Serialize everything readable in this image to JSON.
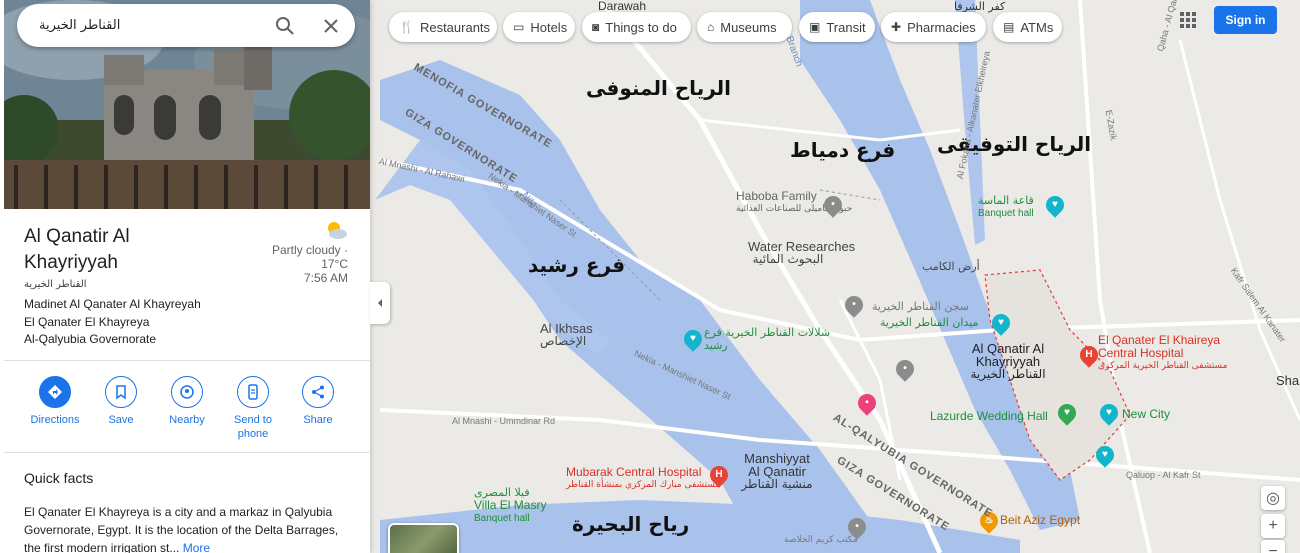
{
  "search": {
    "value": "القناطر الخيرية"
  },
  "place": {
    "name": "Al Qanatir Al Khayriyyah",
    "name_ar": "القناطر الخيرية",
    "address": [
      "Madinet Al Qanater Al Khayreyah",
      "El Qanater El Khayreya",
      "Al-Qalyubia Governorate"
    ]
  },
  "weather": {
    "condition": "Partly cloudy ·",
    "temp": "17°C",
    "time": "7:56 AM"
  },
  "actions": [
    {
      "label": "Directions",
      "icon": "directions-icon"
    },
    {
      "label": "Save",
      "icon": "bookmark-icon"
    },
    {
      "label": "Nearby",
      "icon": "nearby-icon"
    },
    {
      "label": "Send to phone",
      "icon": "send-to-phone-icon"
    },
    {
      "label": "Share",
      "icon": "share-icon"
    }
  ],
  "quick_facts": {
    "title": "Quick facts",
    "body": "El Qanater El Khayreya is a city and a markaz in Qalyubia Governorate, Egypt. It is the location of the Delta Barrages, the first modern irrigation st...",
    "more": "More"
  },
  "chips": [
    {
      "label": "Restaurants",
      "icon": "restaurant-icon"
    },
    {
      "label": "Hotels",
      "icon": "hotel-icon"
    },
    {
      "label": "Things to do",
      "icon": "camera-icon"
    },
    {
      "label": "Museums",
      "icon": "museum-icon"
    },
    {
      "label": "Transit",
      "icon": "transit-icon"
    },
    {
      "label": "Pharmacies",
      "icon": "pharmacy-icon"
    },
    {
      "label": "ATMs",
      "icon": "atm-icon"
    }
  ],
  "header": {
    "signin": "Sign in"
  },
  "map": {
    "annotations": {
      "menoufy": "الرياح المنوفى",
      "damietta": "فرع دمياط",
      "tawfiqi": "الرياح التوفيقى",
      "rashid": "فرع رشيد",
      "beheira": "رياح البحيرة"
    },
    "places": {
      "darawah": "Darawah",
      "kafr": "كفر الشرفا",
      "haboba_en": "Haboba Family",
      "haboba_ar": "حبوبة فاميلى للصناعات الغذائية",
      "water_en": "Water Researches",
      "water_ar": "البحوث المائية",
      "banquet_ar": "قاعة الماسة",
      "banquet_en": "Banquet hall",
      "ard_ar": "أرض الكامب",
      "prison_ar": "سجن القناطر الخيرية",
      "square_ar": "ميدان القناطر الخيرية",
      "ikhsas_en": "Al Ikhsas",
      "ikhsas_ar": "الإخصاص",
      "falls_ar": "شلالات القناطر الخيرية فرع رشيد",
      "qanatir_en": "Al Qanatir Al Khayriyyah",
      "qanatir_ar": "القناطر الخيرية",
      "hospital_en": "El Qanater El Khaireya Central Hospital",
      "hospital_ar": "مستشفى القناطر الخيرية المركزى",
      "lazurde": "Lazurde Wedding Hall",
      "newcity": "New City",
      "mubarak_en": "Mubarak Central Hospital",
      "mubarak_ar": "مستشفى مبارك المركزي بمنشأة القناطر",
      "manshiyyat_en": "Manshiyyat Al Qanatir",
      "manshiyyat_ar": "منشية القناطر",
      "villa_ar": "فيلا المصرى",
      "villa_en": "Villa El Masry",
      "villa_type": "Banquet hall",
      "beit_aziz": "Beit Aziz Egypt",
      "sha": "Sha",
      "qaluop": "Qaluop - Al Kafr St",
      "karim": "مكتب كريم الخلاصة"
    },
    "roads": {
      "menofia_gov": "MENOFIA GOVERNORATE",
      "giza_gov": "GIZA GOVERNORATE",
      "qalyubia_gov": "AL-QALYUBIA GOVERNORATE",
      "giza_gov2": "GIZA GOVERNORATE",
      "nile": "Nile",
      "nekia": "Nekia - Manshiet Naser St",
      "nekia2": "Nekia - Manshiet Naser St",
      "al_mnashi": "Al Mnashi - Al Rahawi",
      "al_mnashi2": "Al Mnashi - Ummdinar Rd",
      "kafr_salem": "Kafr Salem Al Kanater",
      "ezzat": "E-Zazik",
      "fokaha": "Al Fokaha - Alkanater Elkheireya",
      "branch": "Branch",
      "qaha": "Qaha - Al Qal"
    }
  }
}
